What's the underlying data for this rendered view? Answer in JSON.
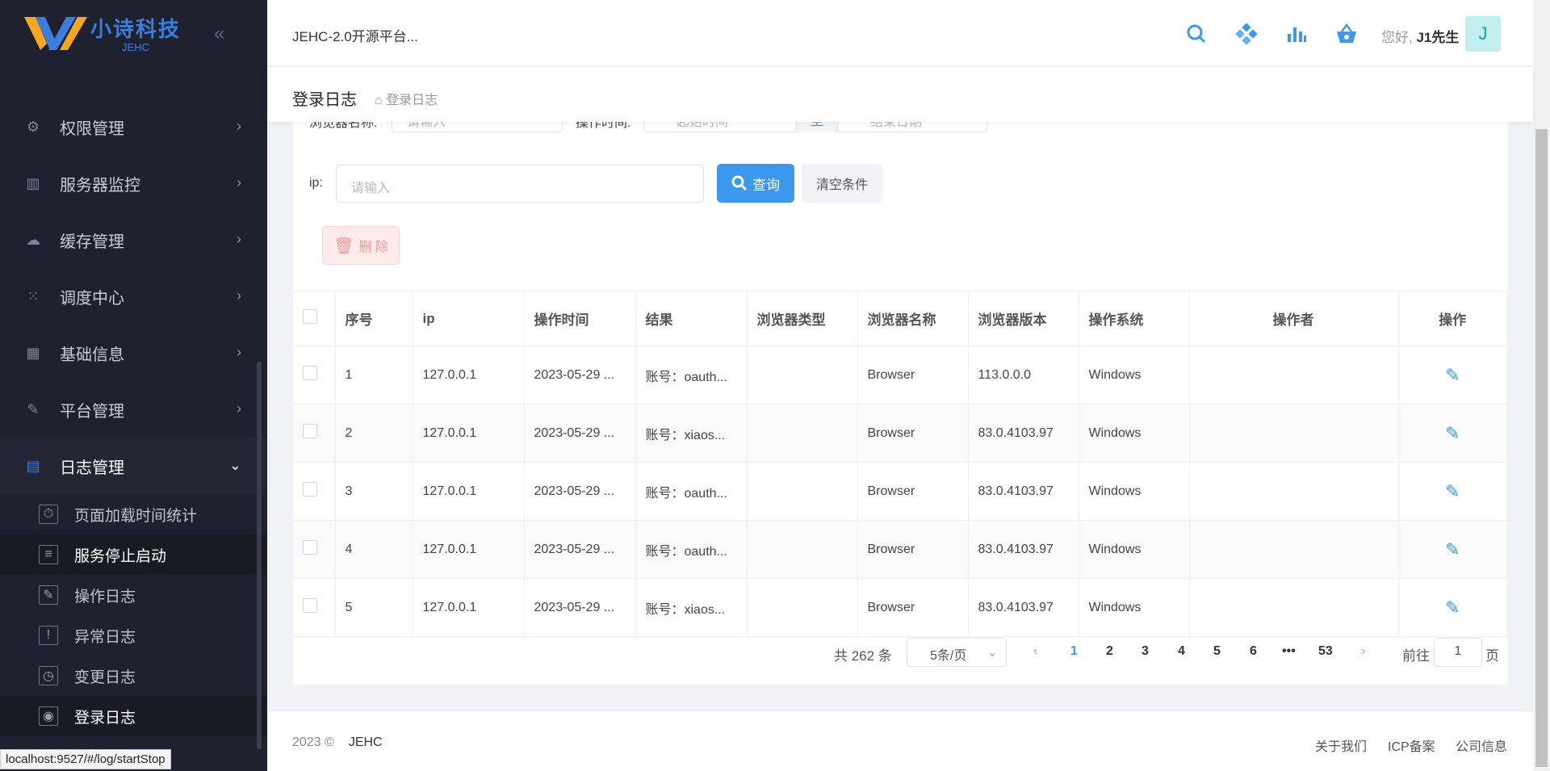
{
  "brand": {
    "name_cn": "小诗科技",
    "name_en": "JEHC"
  },
  "sidebar": {
    "items": [
      {
        "label": "权限管理"
      },
      {
        "label": "服务器监控"
      },
      {
        "label": "缓存管理"
      },
      {
        "label": "调度中心"
      },
      {
        "label": "基础信息"
      },
      {
        "label": "平台管理"
      },
      {
        "label": "日志管理"
      }
    ],
    "sub_items": [
      {
        "label": "页面加载时间统计"
      },
      {
        "label": "服务停止启动"
      },
      {
        "label": "操作日志"
      },
      {
        "label": "异常日志"
      },
      {
        "label": "变更日志"
      },
      {
        "label": "登录日志"
      }
    ]
  },
  "status_url": "localhost:9527/#/log/startStop",
  "header": {
    "title": "JEHC-2.0开源平台...",
    "greeting": "您好,",
    "username": "J1先生",
    "avatar_letter": "J"
  },
  "page": {
    "title": "登录日志",
    "breadcrumb": "登录日志"
  },
  "filters": {
    "browser_name_label": "浏览器名称:",
    "browser_name_placeholder": "请输入",
    "op_time_label": "操作时间:",
    "start_placeholder": "起始时间",
    "to_label": "至",
    "end_placeholder": "结束日期",
    "ip_label": "ip:",
    "ip_placeholder": "请输入",
    "query_label": "查询",
    "clear_label": "清空条件",
    "delete_label": "删 除"
  },
  "table": {
    "headers": [
      "序号",
      "ip",
      "操作时间",
      "结果",
      "浏览器类型",
      "浏览器名称",
      "浏览器版本",
      "操作系统",
      "操作者",
      "操作"
    ],
    "rows": [
      {
        "no": "1",
        "ip": "127.0.0.1",
        "time": "2023-05-29 ...",
        "result": "账号：oauth...",
        "btype": "",
        "bname": "Browser",
        "bver": "113.0.0.0",
        "os": "Windows",
        "operator": ""
      },
      {
        "no": "2",
        "ip": "127.0.0.1",
        "time": "2023-05-29 ...",
        "result": "账号：xiaos...",
        "btype": "",
        "bname": "Browser",
        "bver": "83.0.4103.97",
        "os": "Windows",
        "operator": ""
      },
      {
        "no": "3",
        "ip": "127.0.0.1",
        "time": "2023-05-29 ...",
        "result": "账号：oauth...",
        "btype": "",
        "bname": "Browser",
        "bver": "83.0.4103.97",
        "os": "Windows",
        "operator": ""
      },
      {
        "no": "4",
        "ip": "127.0.0.1",
        "time": "2023-05-29 ...",
        "result": "账号：oauth...",
        "btype": "",
        "bname": "Browser",
        "bver": "83.0.4103.97",
        "os": "Windows",
        "operator": ""
      },
      {
        "no": "5",
        "ip": "127.0.0.1",
        "time": "2023-05-29 ...",
        "result": "账号：xiaos...",
        "btype": "",
        "bname": "Browser",
        "bver": "83.0.4103.97",
        "os": "Windows",
        "operator": ""
      }
    ]
  },
  "pagination": {
    "total": "共 262 条",
    "page_size": "5条/页",
    "pages": [
      "1",
      "2",
      "3",
      "4",
      "5",
      "6",
      "•••",
      "53"
    ],
    "current": "1",
    "goto_label": "前往",
    "goto_value": "1",
    "page_suffix": "页"
  },
  "footer": {
    "year": "2023 ©",
    "brand": "JEHC",
    "links": [
      "关于我们",
      "ICP备案",
      "公司信息"
    ]
  },
  "colors": {
    "primary": "#3c98ec",
    "sidebar_bg": "#1f222e",
    "danger_light": "#fdeaea"
  },
  "icons": [
    "search-icon",
    "puzzle-icon",
    "chart-icon",
    "basket-icon",
    "home-icon",
    "trash-icon",
    "edit-icon"
  ]
}
